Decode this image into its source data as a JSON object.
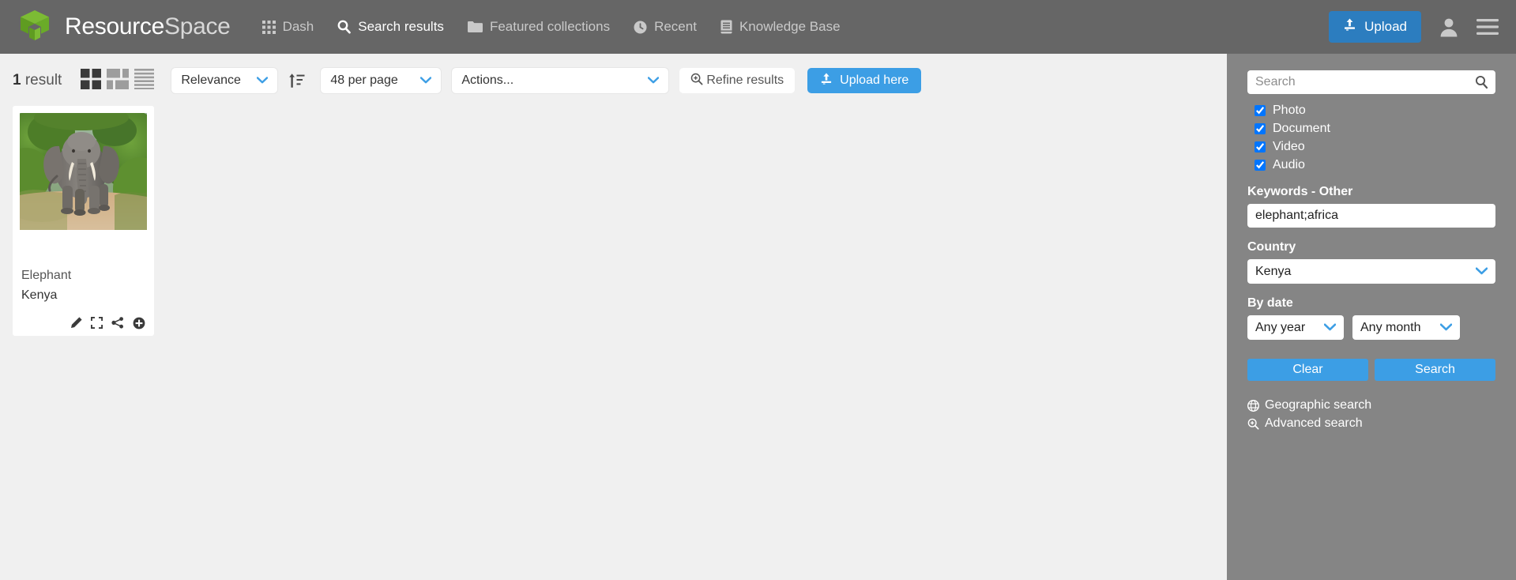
{
  "header": {
    "brand_bold": "Resource",
    "brand_light": "Space",
    "logo_icon": "cube-logo-icon",
    "nav": [
      {
        "label": "Dash",
        "icon": "grid-icon",
        "active": false
      },
      {
        "label": "Search results",
        "icon": "search-icon",
        "active": true
      },
      {
        "label": "Featured collections",
        "icon": "folder-icon",
        "active": false
      },
      {
        "label": "Recent",
        "icon": "clock-icon",
        "active": false
      },
      {
        "label": "Knowledge Base",
        "icon": "book-icon",
        "active": false
      }
    ],
    "upload_label": "Upload",
    "upload_icon": "upload-icon",
    "user_icon": "user-avatar-icon",
    "menu_icon": "hamburger-menu-icon"
  },
  "toolbar": {
    "result_count_number": "1",
    "result_count_label": " result",
    "view_modes": [
      {
        "name": "grid-large",
        "active": true
      },
      {
        "name": "grid-small",
        "active": false
      },
      {
        "name": "list-view",
        "active": false
      }
    ],
    "sort_by": "Relevance",
    "sort_direction_icon": "sort-ascending-icon",
    "per_page": "48 per page",
    "actions": "Actions...",
    "refine_label": "Refine results",
    "refine_icon": "magnifier-plus-icon",
    "upload_here_label": "Upload here",
    "upload_here_icon": "upload-icon"
  },
  "results": [
    {
      "title": "Elephant",
      "subtitle": "Kenya",
      "thumb_alt": "elephant-photo",
      "actions": [
        {
          "name": "edit-icon",
          "label": "Edit"
        },
        {
          "name": "expand-icon",
          "label": "Preview"
        },
        {
          "name": "share-icon",
          "label": "Share"
        },
        {
          "name": "add-to-collection-icon",
          "label": "Add"
        }
      ]
    }
  ],
  "sidebar": {
    "search_placeholder": "Search",
    "search_value": "",
    "search_icon": "search-icon",
    "resource_types": [
      {
        "label": "Photo",
        "checked": true
      },
      {
        "label": "Document",
        "checked": true
      },
      {
        "label": "Video",
        "checked": true
      },
      {
        "label": "Audio",
        "checked": true
      }
    ],
    "keywords_label": "Keywords - Other",
    "keywords_value": "elephant;africa",
    "country_label": "Country",
    "country_value": "Kenya",
    "bydate_label": "By date",
    "year_value": "Any year",
    "month_value": "Any month",
    "clear_label": "Clear",
    "search_label": "Search",
    "links": [
      {
        "label": "Geographic search",
        "icon": "globe-icon"
      },
      {
        "label": "Advanced search",
        "icon": "magnifier-plus-icon"
      }
    ]
  },
  "colors": {
    "header_bg": "#666666",
    "sidebar_bg": "#858585",
    "accent_blue": "#3c9ee5",
    "upload_blue": "#2c7dbf",
    "logo_green": "#6aa52a"
  }
}
